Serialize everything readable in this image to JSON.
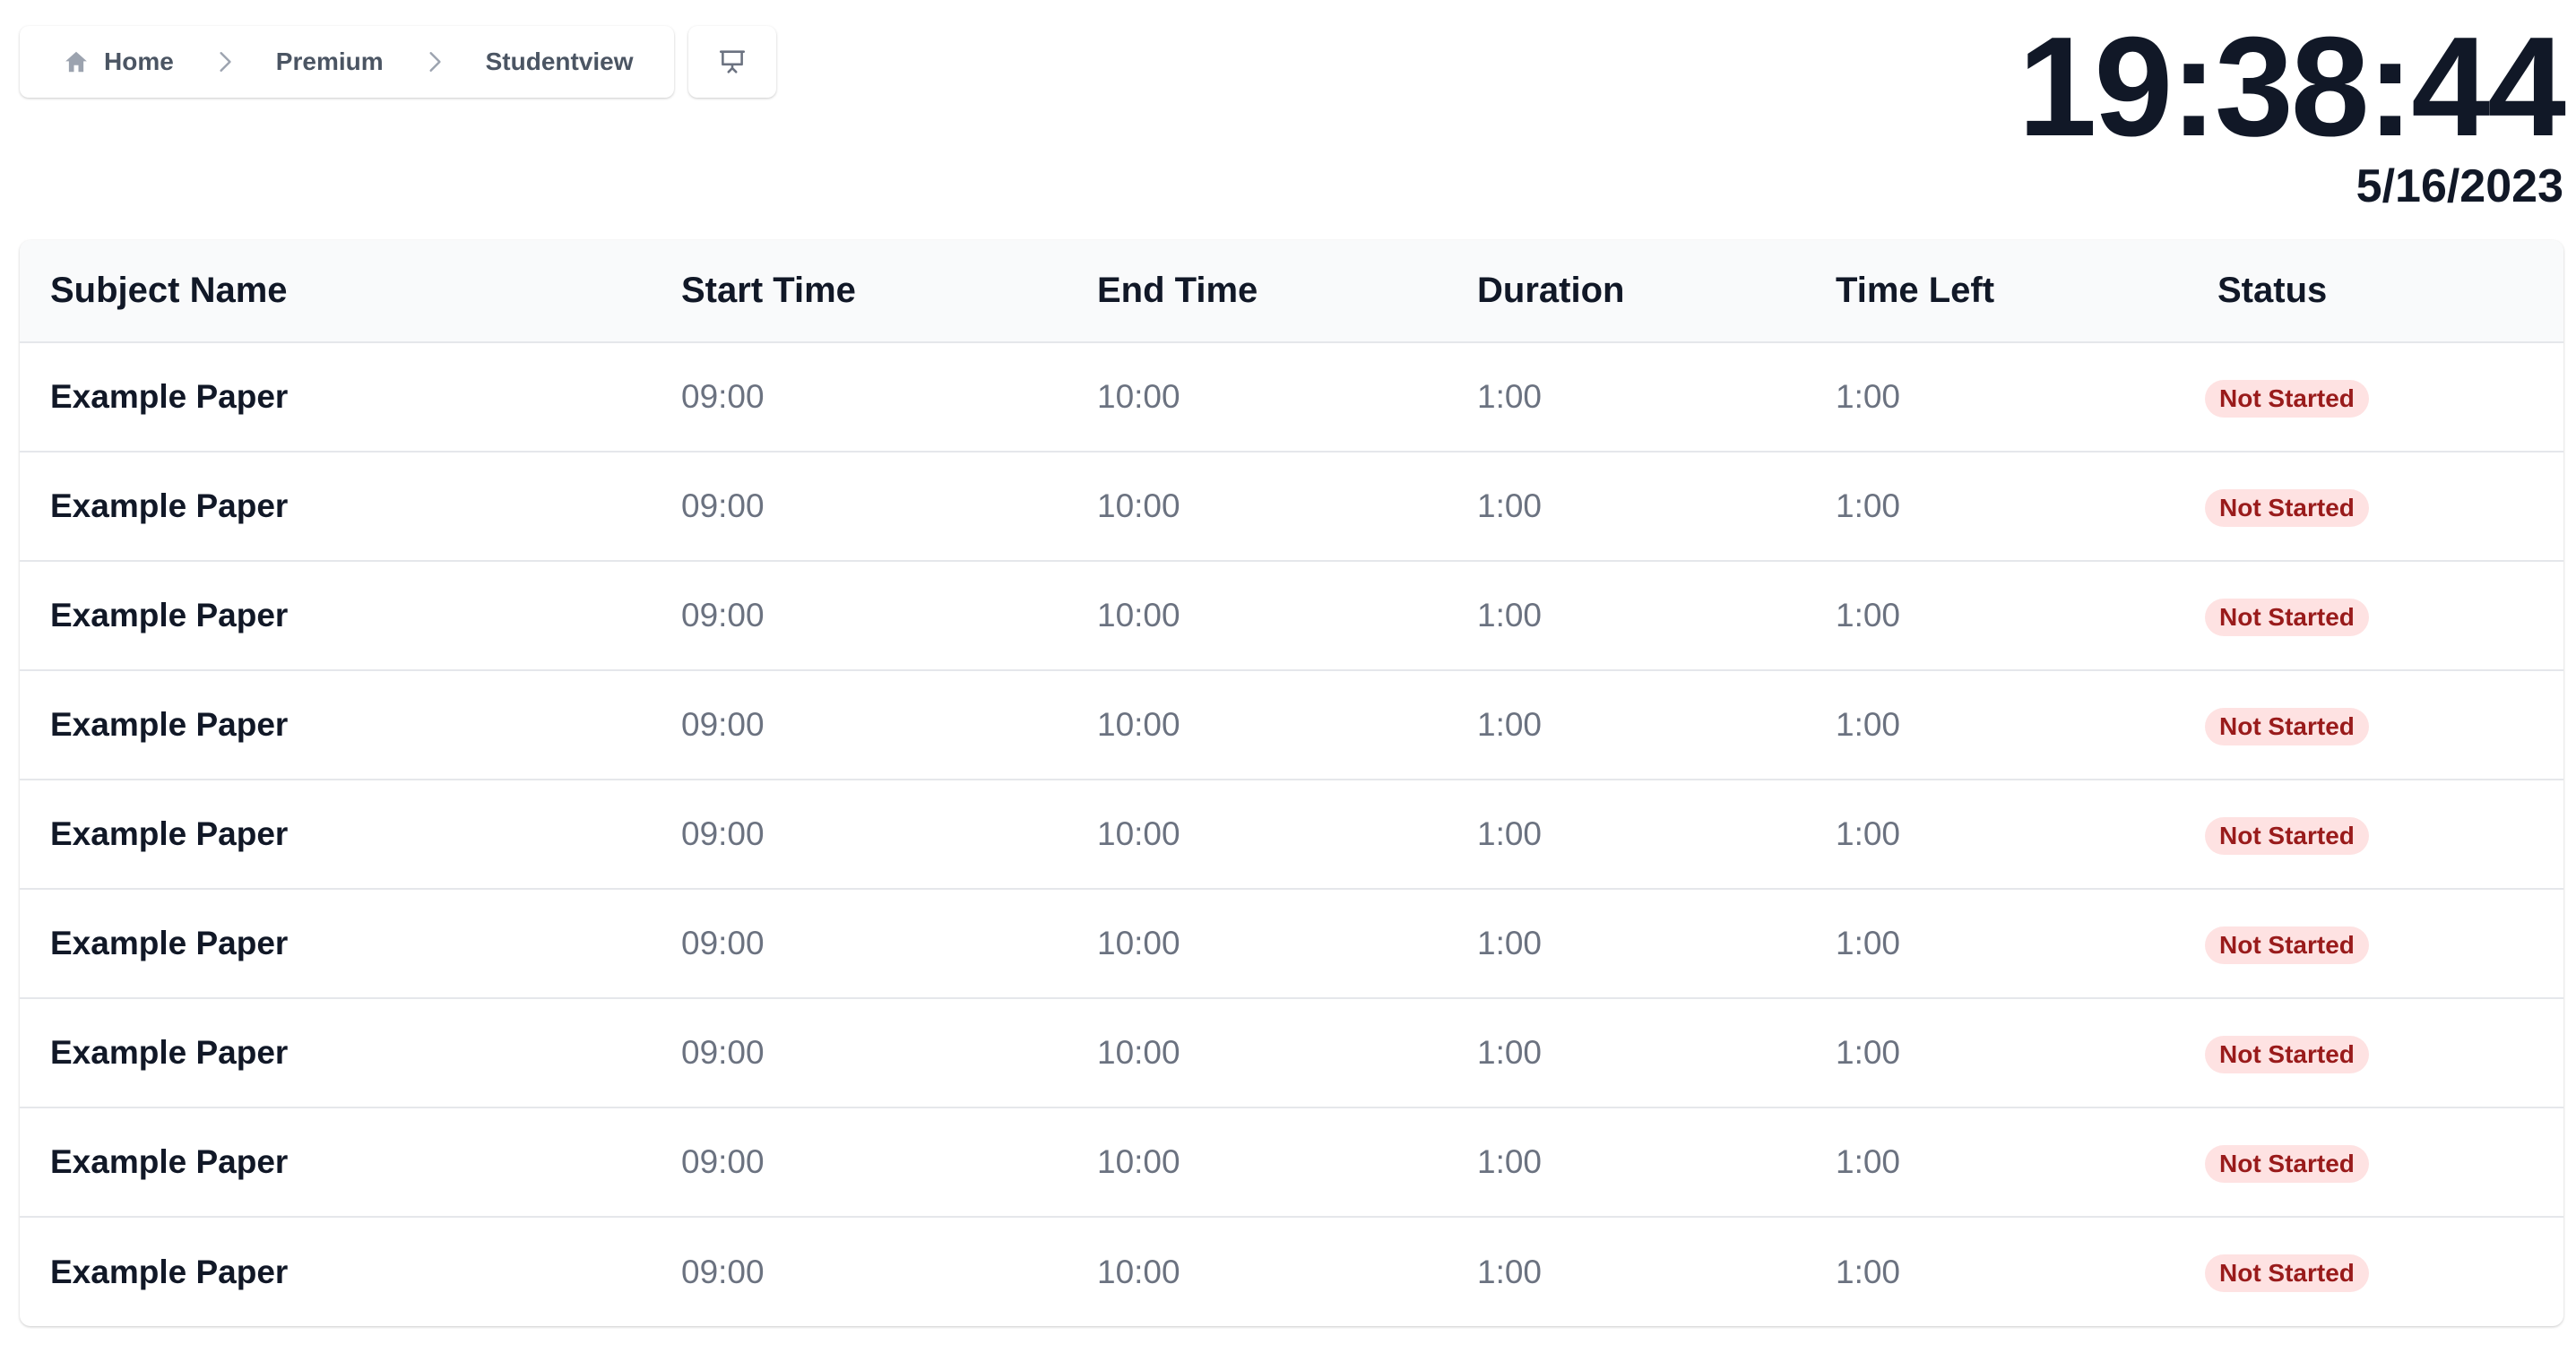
{
  "breadcrumb": {
    "items": [
      {
        "label": "Home",
        "icon": "home-icon"
      },
      {
        "label": "Premium"
      },
      {
        "label": "Studentview"
      }
    ]
  },
  "toolbar": {
    "present_icon": "presentation-icon"
  },
  "clock": {
    "time": "19:38:44",
    "date": "5/16/2023"
  },
  "table": {
    "columns": [
      "Subject Name",
      "Start Time",
      "End Time",
      "Duration",
      "Time Left",
      "Status"
    ],
    "rows": [
      {
        "subject": "Example Paper",
        "start": "09:00",
        "end": "10:00",
        "duration": "1:00",
        "time_left": "1:00",
        "status": "Not Started"
      },
      {
        "subject": "Example Paper",
        "start": "09:00",
        "end": "10:00",
        "duration": "1:00",
        "time_left": "1:00",
        "status": "Not Started"
      },
      {
        "subject": "Example Paper",
        "start": "09:00",
        "end": "10:00",
        "duration": "1:00",
        "time_left": "1:00",
        "status": "Not Started"
      },
      {
        "subject": "Example Paper",
        "start": "09:00",
        "end": "10:00",
        "duration": "1:00",
        "time_left": "1:00",
        "status": "Not Started"
      },
      {
        "subject": "Example Paper",
        "start": "09:00",
        "end": "10:00",
        "duration": "1:00",
        "time_left": "1:00",
        "status": "Not Started"
      },
      {
        "subject": "Example Paper",
        "start": "09:00",
        "end": "10:00",
        "duration": "1:00",
        "time_left": "1:00",
        "status": "Not Started"
      },
      {
        "subject": "Example Paper",
        "start": "09:00",
        "end": "10:00",
        "duration": "1:00",
        "time_left": "1:00",
        "status": "Not Started"
      },
      {
        "subject": "Example Paper",
        "start": "09:00",
        "end": "10:00",
        "duration": "1:00",
        "time_left": "1:00",
        "status": "Not Started"
      },
      {
        "subject": "Example Paper",
        "start": "09:00",
        "end": "10:00",
        "duration": "1:00",
        "time_left": "1:00",
        "status": "Not Started"
      }
    ]
  },
  "colors": {
    "badge_bg": "#fee2e2",
    "badge_text": "#991b1b",
    "heading_text": "#111827",
    "muted_text": "#6b7280"
  }
}
